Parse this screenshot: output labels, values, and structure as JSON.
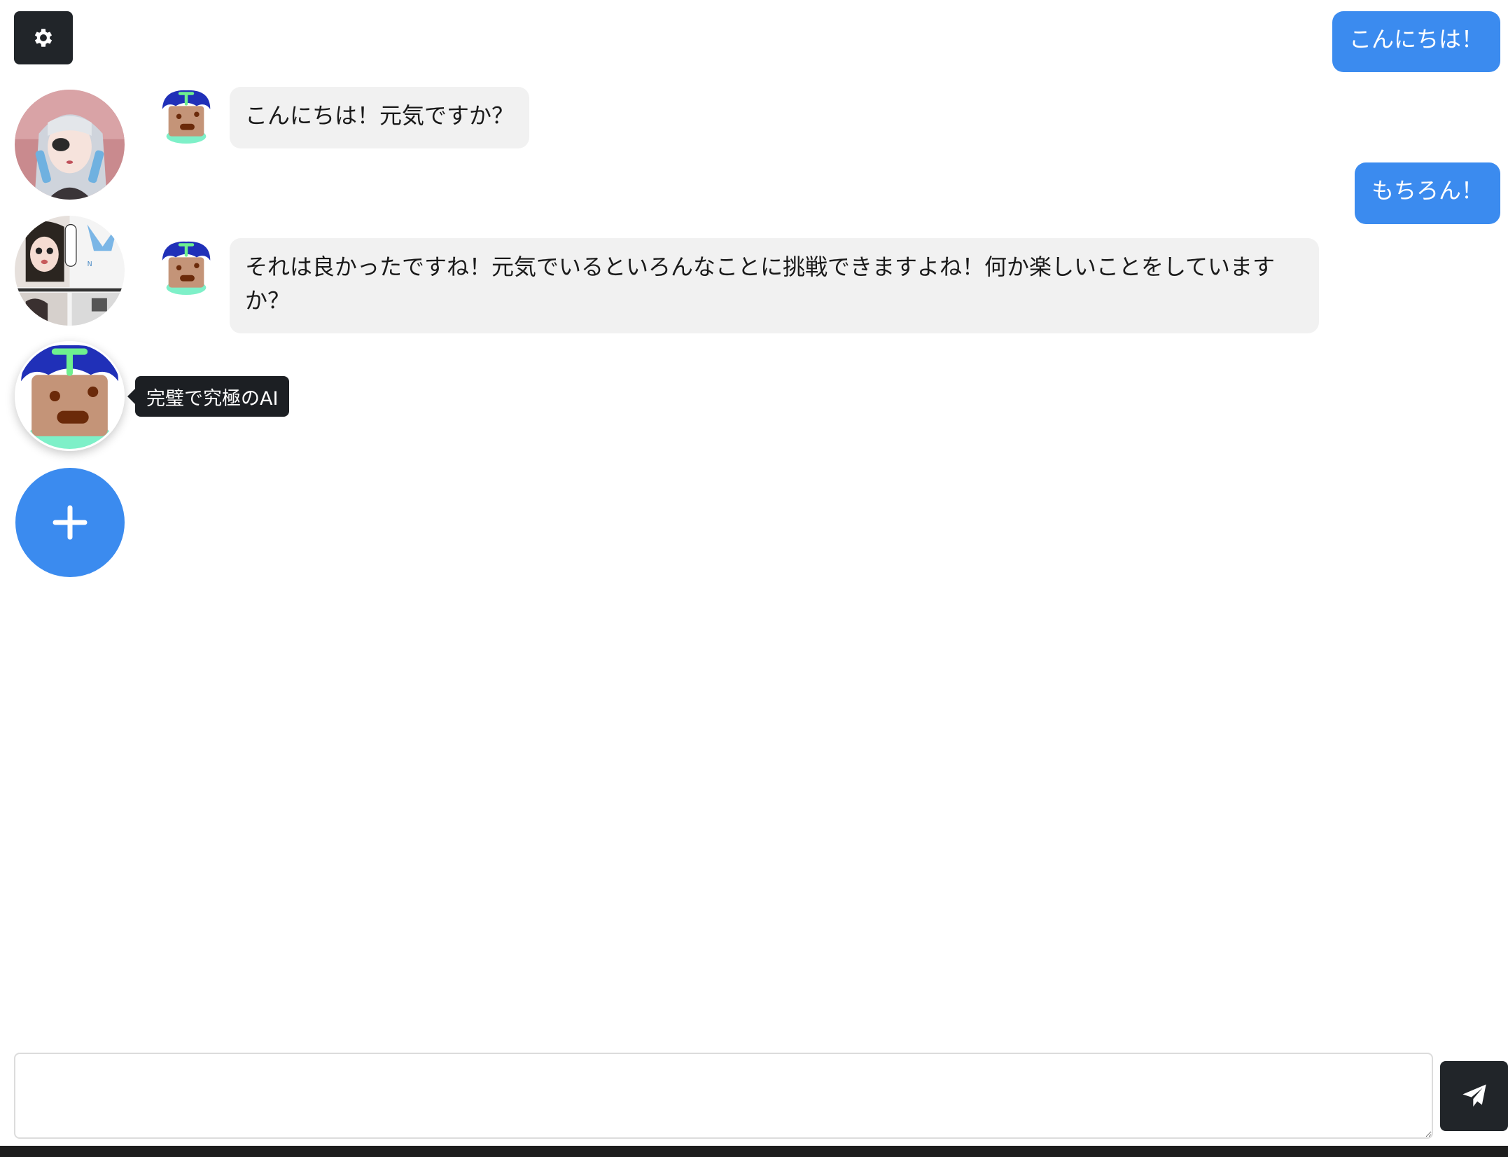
{
  "settings": {
    "icon": "gear-icon"
  },
  "sidebar": {
    "characters": [
      {
        "name": "character-1",
        "style": "anime-girl-silver-hair"
      },
      {
        "name": "character-2",
        "style": "manga-collage"
      },
      {
        "name": "character-3",
        "style": "drawn-face-blue-hat",
        "tooltip": "完璧で究極のAI",
        "active": true
      }
    ],
    "add_icon": "plus-icon"
  },
  "chat": {
    "messages": [
      {
        "role": "user",
        "text": "こんにちは！"
      },
      {
        "role": "assistant",
        "text": "こんにちは！元気ですか？"
      },
      {
        "role": "user",
        "text": "もちろん！"
      },
      {
        "role": "assistant",
        "text": "それは良かったですね！元気でいるといろんなことに挑戦できますよね！何か楽しいことをしていますか？"
      }
    ]
  },
  "composer": {
    "value": "",
    "placeholder": "",
    "send_icon": "paper-plane-icon"
  },
  "colors": {
    "accent": "#3b8bef",
    "dark": "#212529",
    "ai_bubble": "#f1f1f1"
  }
}
